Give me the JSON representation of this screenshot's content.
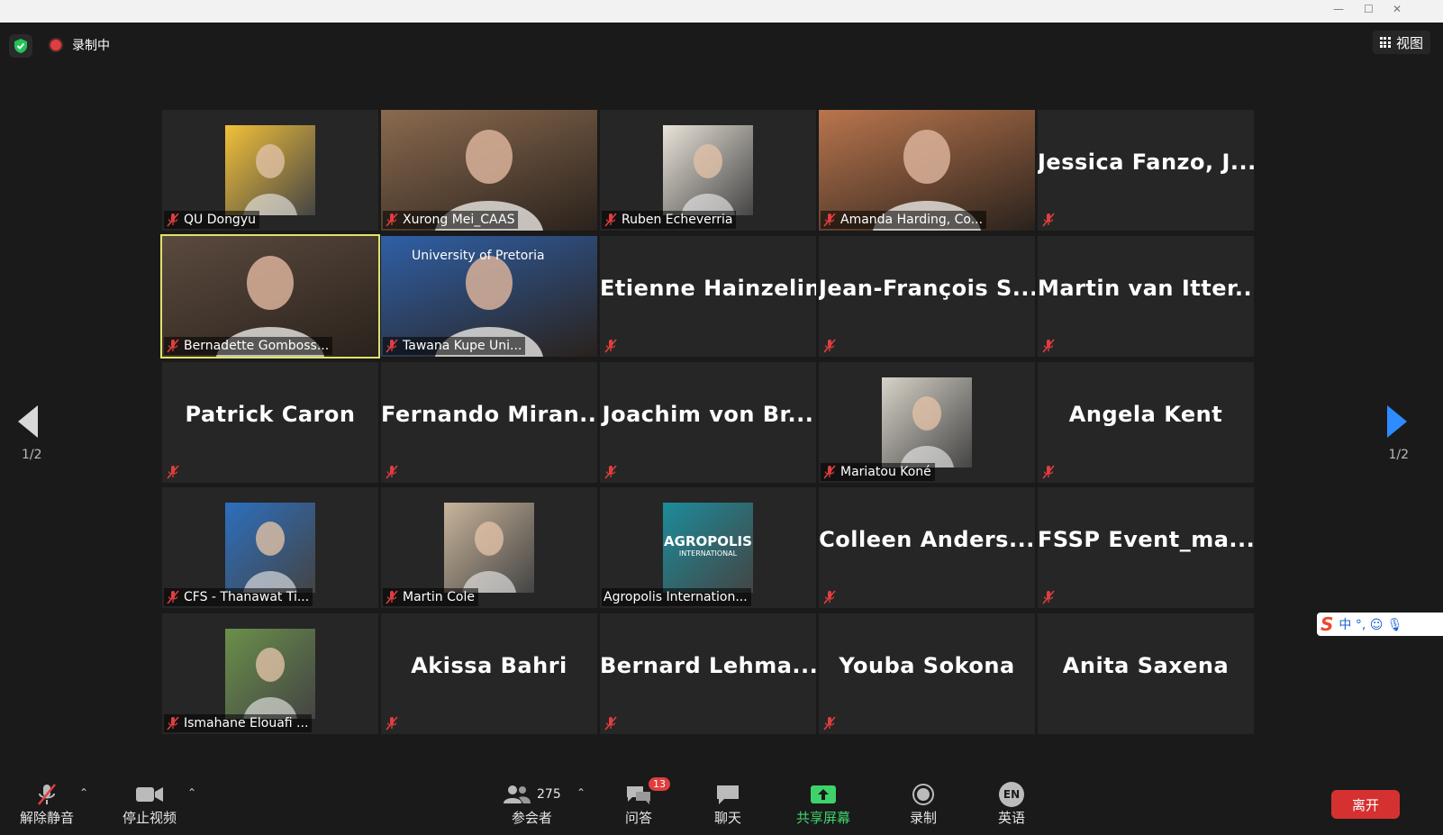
{
  "window": {
    "min": "—",
    "max": "☐",
    "close": "✕"
  },
  "header": {
    "recording_label": "录制中",
    "view_label": "视图"
  },
  "pagination": {
    "left": "1/2",
    "right": "1/2"
  },
  "tiles": [
    {
      "name": "QU Dongyu",
      "kind": "thumb",
      "bg": "#f2c13a"
    },
    {
      "name": "Xurong Mei_CAAS",
      "kind": "video",
      "bg": "#8a6a4f"
    },
    {
      "name": "Ruben Echeverria",
      "kind": "thumb",
      "bg": "#e9e3d8"
    },
    {
      "name": "Amanda Harding, Co...",
      "kind": "video",
      "bg": "#b9754d"
    },
    {
      "name": "Jessica  Fanzo,  J...",
      "kind": "text"
    },
    {
      "name": "Bernadette Gomboss...",
      "kind": "video",
      "bg": "#5b4a3e",
      "active": true
    },
    {
      "name": "Tawana Kupe Uni...",
      "kind": "video",
      "bg": "#2f5fa6",
      "banner": "University of Pretoria"
    },
    {
      "name": "Etienne Hainzelin",
      "kind": "text"
    },
    {
      "name": "Jean-François  S...",
      "kind": "text"
    },
    {
      "name": "Martin  van  Itter...",
      "kind": "text"
    },
    {
      "name": "Patrick Caron",
      "kind": "text"
    },
    {
      "name": "Fernando  Miran...",
      "kind": "text"
    },
    {
      "name": "Joachim  von  Br...",
      "kind": "text"
    },
    {
      "name": "Mariatou Koné",
      "kind": "thumb",
      "bg": "#d8d3c8"
    },
    {
      "name": "Angela Kent",
      "kind": "text"
    },
    {
      "name": "CFS - Thanawat Ti...",
      "kind": "thumb",
      "bg": "#2c6fbf"
    },
    {
      "name": "Martin Cole",
      "kind": "thumb",
      "bg": "#c9b49a"
    },
    {
      "name": "Agropolis Internation...",
      "kind": "thumb",
      "bg": "#1c8c9a",
      "logo": "AGROPOLIS",
      "logo_sub": "INTERNATIONAL",
      "muted": false
    },
    {
      "name": "Colleen  Anders...",
      "kind": "text"
    },
    {
      "name": "FSSP  Event_ma...",
      "kind": "text"
    },
    {
      "name": "Ismahane Elouafi ...",
      "kind": "thumb",
      "bg": "#6a8f4a"
    },
    {
      "name": "Akissa Bahri",
      "kind": "text"
    },
    {
      "name": "Bernard  Lehma...",
      "kind": "text"
    },
    {
      "name": "Youba Sokona",
      "kind": "text"
    },
    {
      "name": "Anita Saxena",
      "kind": "text",
      "muted": false
    }
  ],
  "ime": {
    "logo": "S",
    "chars": "中 °, ☺ 🎙"
  },
  "toolbar": {
    "unmute": "解除静音",
    "stop_video": "停止视频",
    "participants": "参会者",
    "participants_count": "275",
    "qa": "问答",
    "qa_badge": "13",
    "chat": "聊天",
    "share": "共享屏幕",
    "record": "录制",
    "language": "英语",
    "language_code": "EN",
    "leave": "离开"
  },
  "colors": {
    "active_border": "#dfe36a",
    "share_green": "#3fd26a",
    "leave_red": "#d63131",
    "arrow_blue": "#2d8cff"
  }
}
